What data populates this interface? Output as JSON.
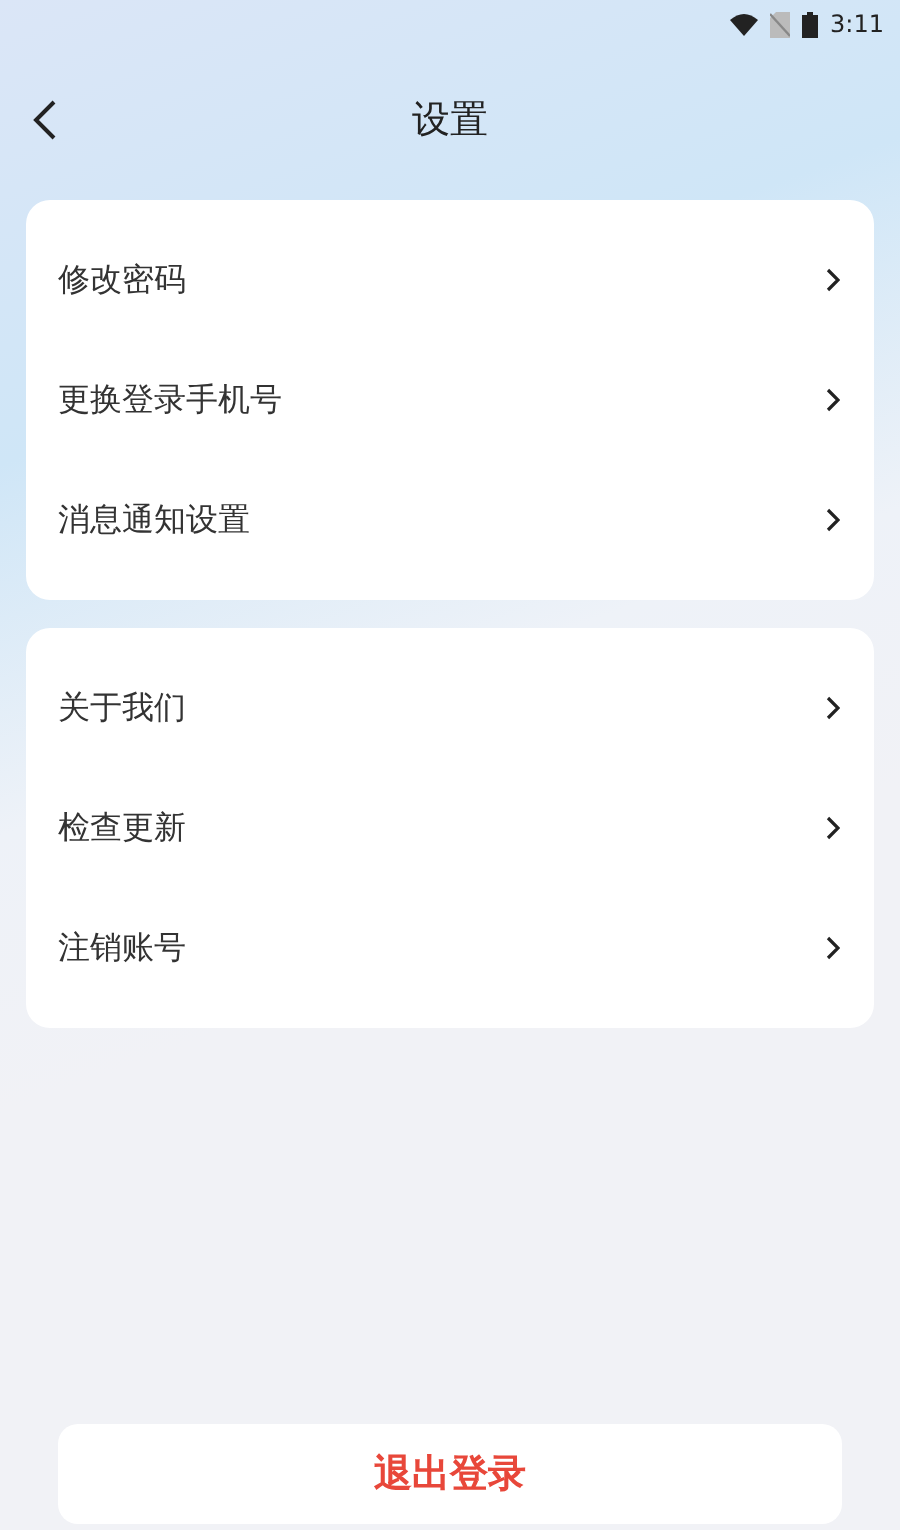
{
  "status_bar": {
    "time": "3:11"
  },
  "header": {
    "title": "设置"
  },
  "groups": [
    {
      "items": [
        {
          "label": "修改密码"
        },
        {
          "label": "更换登录手机号"
        },
        {
          "label": "消息通知设置"
        }
      ]
    },
    {
      "items": [
        {
          "label": "关于我们"
        },
        {
          "label": "检查更新"
        },
        {
          "label": "注销账号"
        }
      ]
    }
  ],
  "logout_button": {
    "label": "退出登录"
  }
}
